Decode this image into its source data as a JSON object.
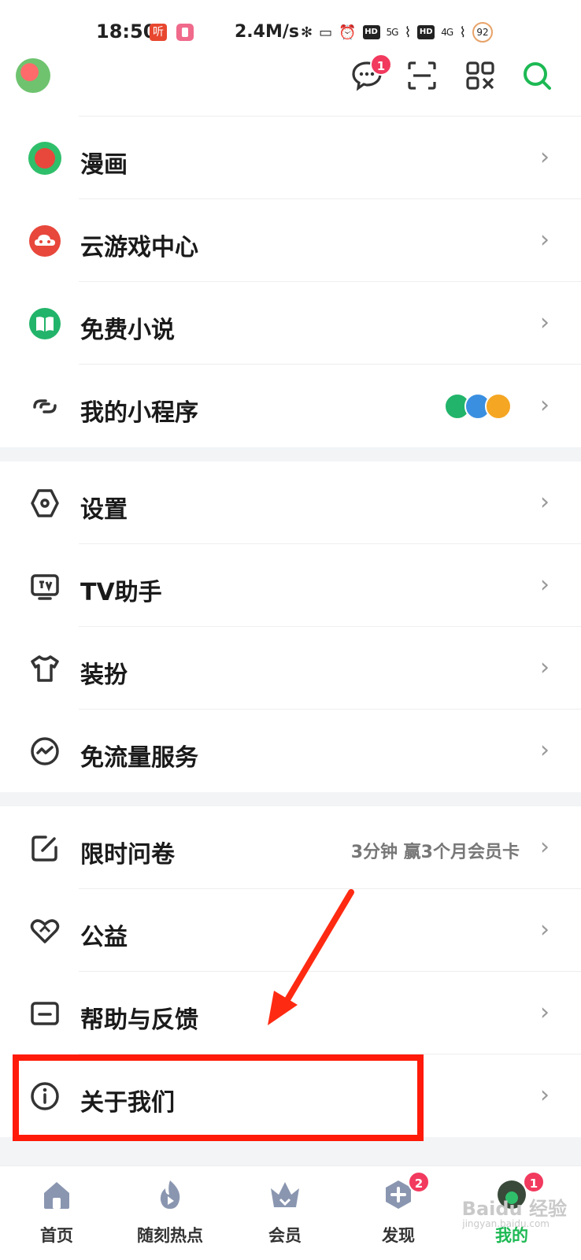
{
  "status_bar": {
    "time": "18:50",
    "ting_icon": "听",
    "speed": "2.4M/s",
    "hd1": "HD",
    "sig1": "5G",
    "hd2": "HD",
    "sig2": "4G",
    "battery": "92"
  },
  "header": {
    "messages_badge": "1"
  },
  "section1": [
    {
      "label": "漫画",
      "icon": "manhua-icon"
    },
    {
      "label": "云游戏中心",
      "icon": "cloud-game-icon"
    },
    {
      "label": "免费小说",
      "icon": "novel-icon"
    },
    {
      "label": "我的小程序",
      "icon": "mini-program-icon"
    }
  ],
  "section2": [
    {
      "label": "设置",
      "icon": "settings-icon"
    },
    {
      "label": "TV助手",
      "icon": "tv-icon"
    },
    {
      "label": "装扮",
      "icon": "tshirt-icon"
    },
    {
      "label": "免流量服务",
      "icon": "data-free-icon"
    }
  ],
  "section3": [
    {
      "label": "限时问卷",
      "icon": "survey-icon",
      "extra": "3分钟 赢3个月会员卡"
    },
    {
      "label": "公益",
      "icon": "charity-icon"
    },
    {
      "label": "帮助与反馈",
      "icon": "feedback-icon"
    },
    {
      "label": "关于我们",
      "icon": "info-icon"
    }
  ],
  "chevron": "›",
  "bottom_nav": [
    {
      "label": "首页",
      "icon": "home-icon"
    },
    {
      "label": "随刻热点",
      "icon": "flame-icon"
    },
    {
      "label": "会员",
      "icon": "crown-icon"
    },
    {
      "label": "发现",
      "icon": "discover-icon",
      "badge": "2"
    },
    {
      "label": "我的",
      "icon": "profile-icon",
      "badge": "1",
      "active": true
    }
  ],
  "watermark": {
    "main": "Baidu 经验",
    "sub": "jingyan.baidu.com"
  },
  "colors": {
    "accent": "#1db954",
    "badge": "#f23a5e",
    "highlight": "#ff1a0a"
  }
}
